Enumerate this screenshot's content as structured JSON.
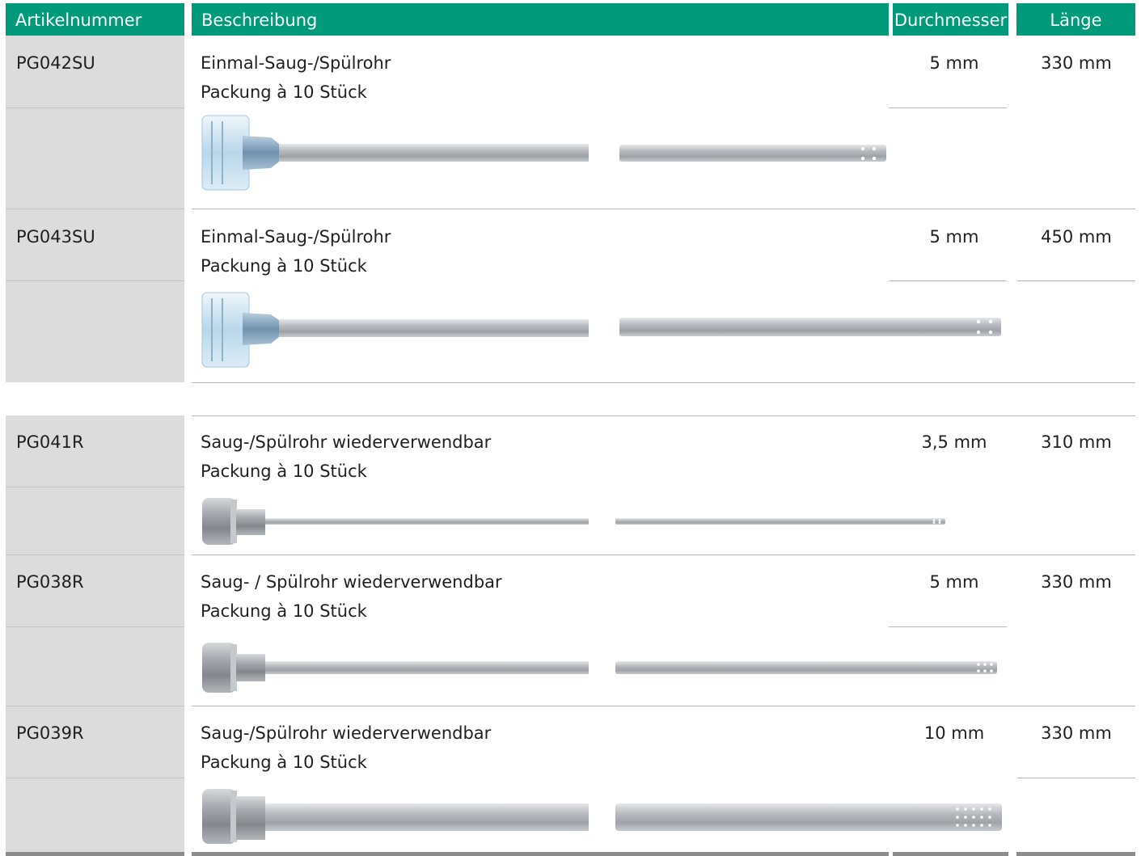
{
  "header": {
    "article_number": "Artikelnummer",
    "description": "Beschreibung",
    "diameter": "Durchmesser",
    "length": "Länge"
  },
  "products": [
    {
      "code": "PG042SU",
      "name": "Einmal-Saug-/Spülrohr",
      "package": "Packung à 10 Stück",
      "diameter": "5 mm",
      "length": "330 mm",
      "handle": "disposable-transparent"
    },
    {
      "code": "PG043SU",
      "name": "Einmal-Saug-/Spülrohr",
      "package": "Packung à 10 Stück",
      "diameter": "5 mm",
      "length": "450 mm",
      "handle": "disposable-transparent"
    },
    {
      "code": "PG041R",
      "name": "Saug-/Spülrohr wiederverwendbar",
      "package": "Packung à 10 Stück",
      "diameter": "3,5 mm",
      "length": "310 mm",
      "handle": "metal"
    },
    {
      "code": "PG038R",
      "name": "Saug- / Spülrohr wiederverwendbar",
      "package": "Packung à 10 Stück",
      "diameter": "5 mm",
      "length": "330 mm",
      "handle": "metal"
    },
    {
      "code": "PG039R",
      "name": "Saug-/Spülrohr wiederverwendbar",
      "package": "Packung à 10 Stück",
      "diameter": "10 mm",
      "length": "330 mm",
      "handle": "metal"
    }
  ],
  "colors": {
    "header_bg": "#00997a",
    "code_column_bg": "#dcdcdc",
    "rule": "#b5b5b5",
    "footer_rule": "#8c8c8c"
  }
}
